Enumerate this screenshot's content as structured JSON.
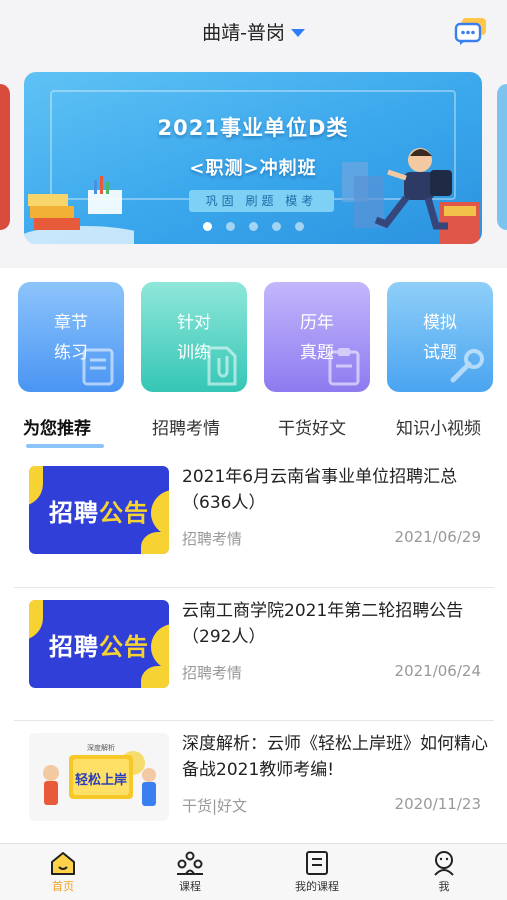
{
  "header": {
    "city": "曲靖-普岗"
  },
  "banner": {
    "title": "2021事业单位D类",
    "subtitle": "<职测>冲刺班",
    "tagline": "巩固 刷题 模考"
  },
  "tiles": [
    {
      "line1": "章节",
      "line2": "练习"
    },
    {
      "line1": "针对",
      "line2": "训练"
    },
    {
      "line1": "历年",
      "line2": "真题"
    },
    {
      "line1": "模拟",
      "line2": "试题"
    }
  ],
  "tabs": [
    "为您推荐",
    "招聘考情",
    "干货好文",
    "知识小视频"
  ],
  "articles": [
    {
      "title": "2021年6月云南省事业单位招聘汇总（636人）",
      "category": "招聘考情",
      "date": "2021/06/29",
      "thumb_text_a": "招聘",
      "thumb_text_b": "公告"
    },
    {
      "title": "云南工商学院2021年第二轮招聘公告（292人）",
      "category": "招聘考情",
      "date": "2021/06/24",
      "thumb_text_a": "招聘",
      "thumb_text_b": "公告"
    },
    {
      "title": "深度解析：云师《轻松上岸班》如何精心备战2021教师考编!",
      "category": "干货|好文",
      "date": "2020/11/23",
      "thumb_text": "轻松上岸",
      "thumb_small": "深度解析"
    }
  ],
  "nav": [
    {
      "label": "首页"
    },
    {
      "label": "课程"
    },
    {
      "label": "我的课程"
    },
    {
      "label": "我"
    }
  ],
  "colors": {
    "accent": "#2e7cf6",
    "active_nav": "#f0a020",
    "recruit_blue": "#2f3fd8",
    "recruit_yellow": "#f7d233"
  }
}
